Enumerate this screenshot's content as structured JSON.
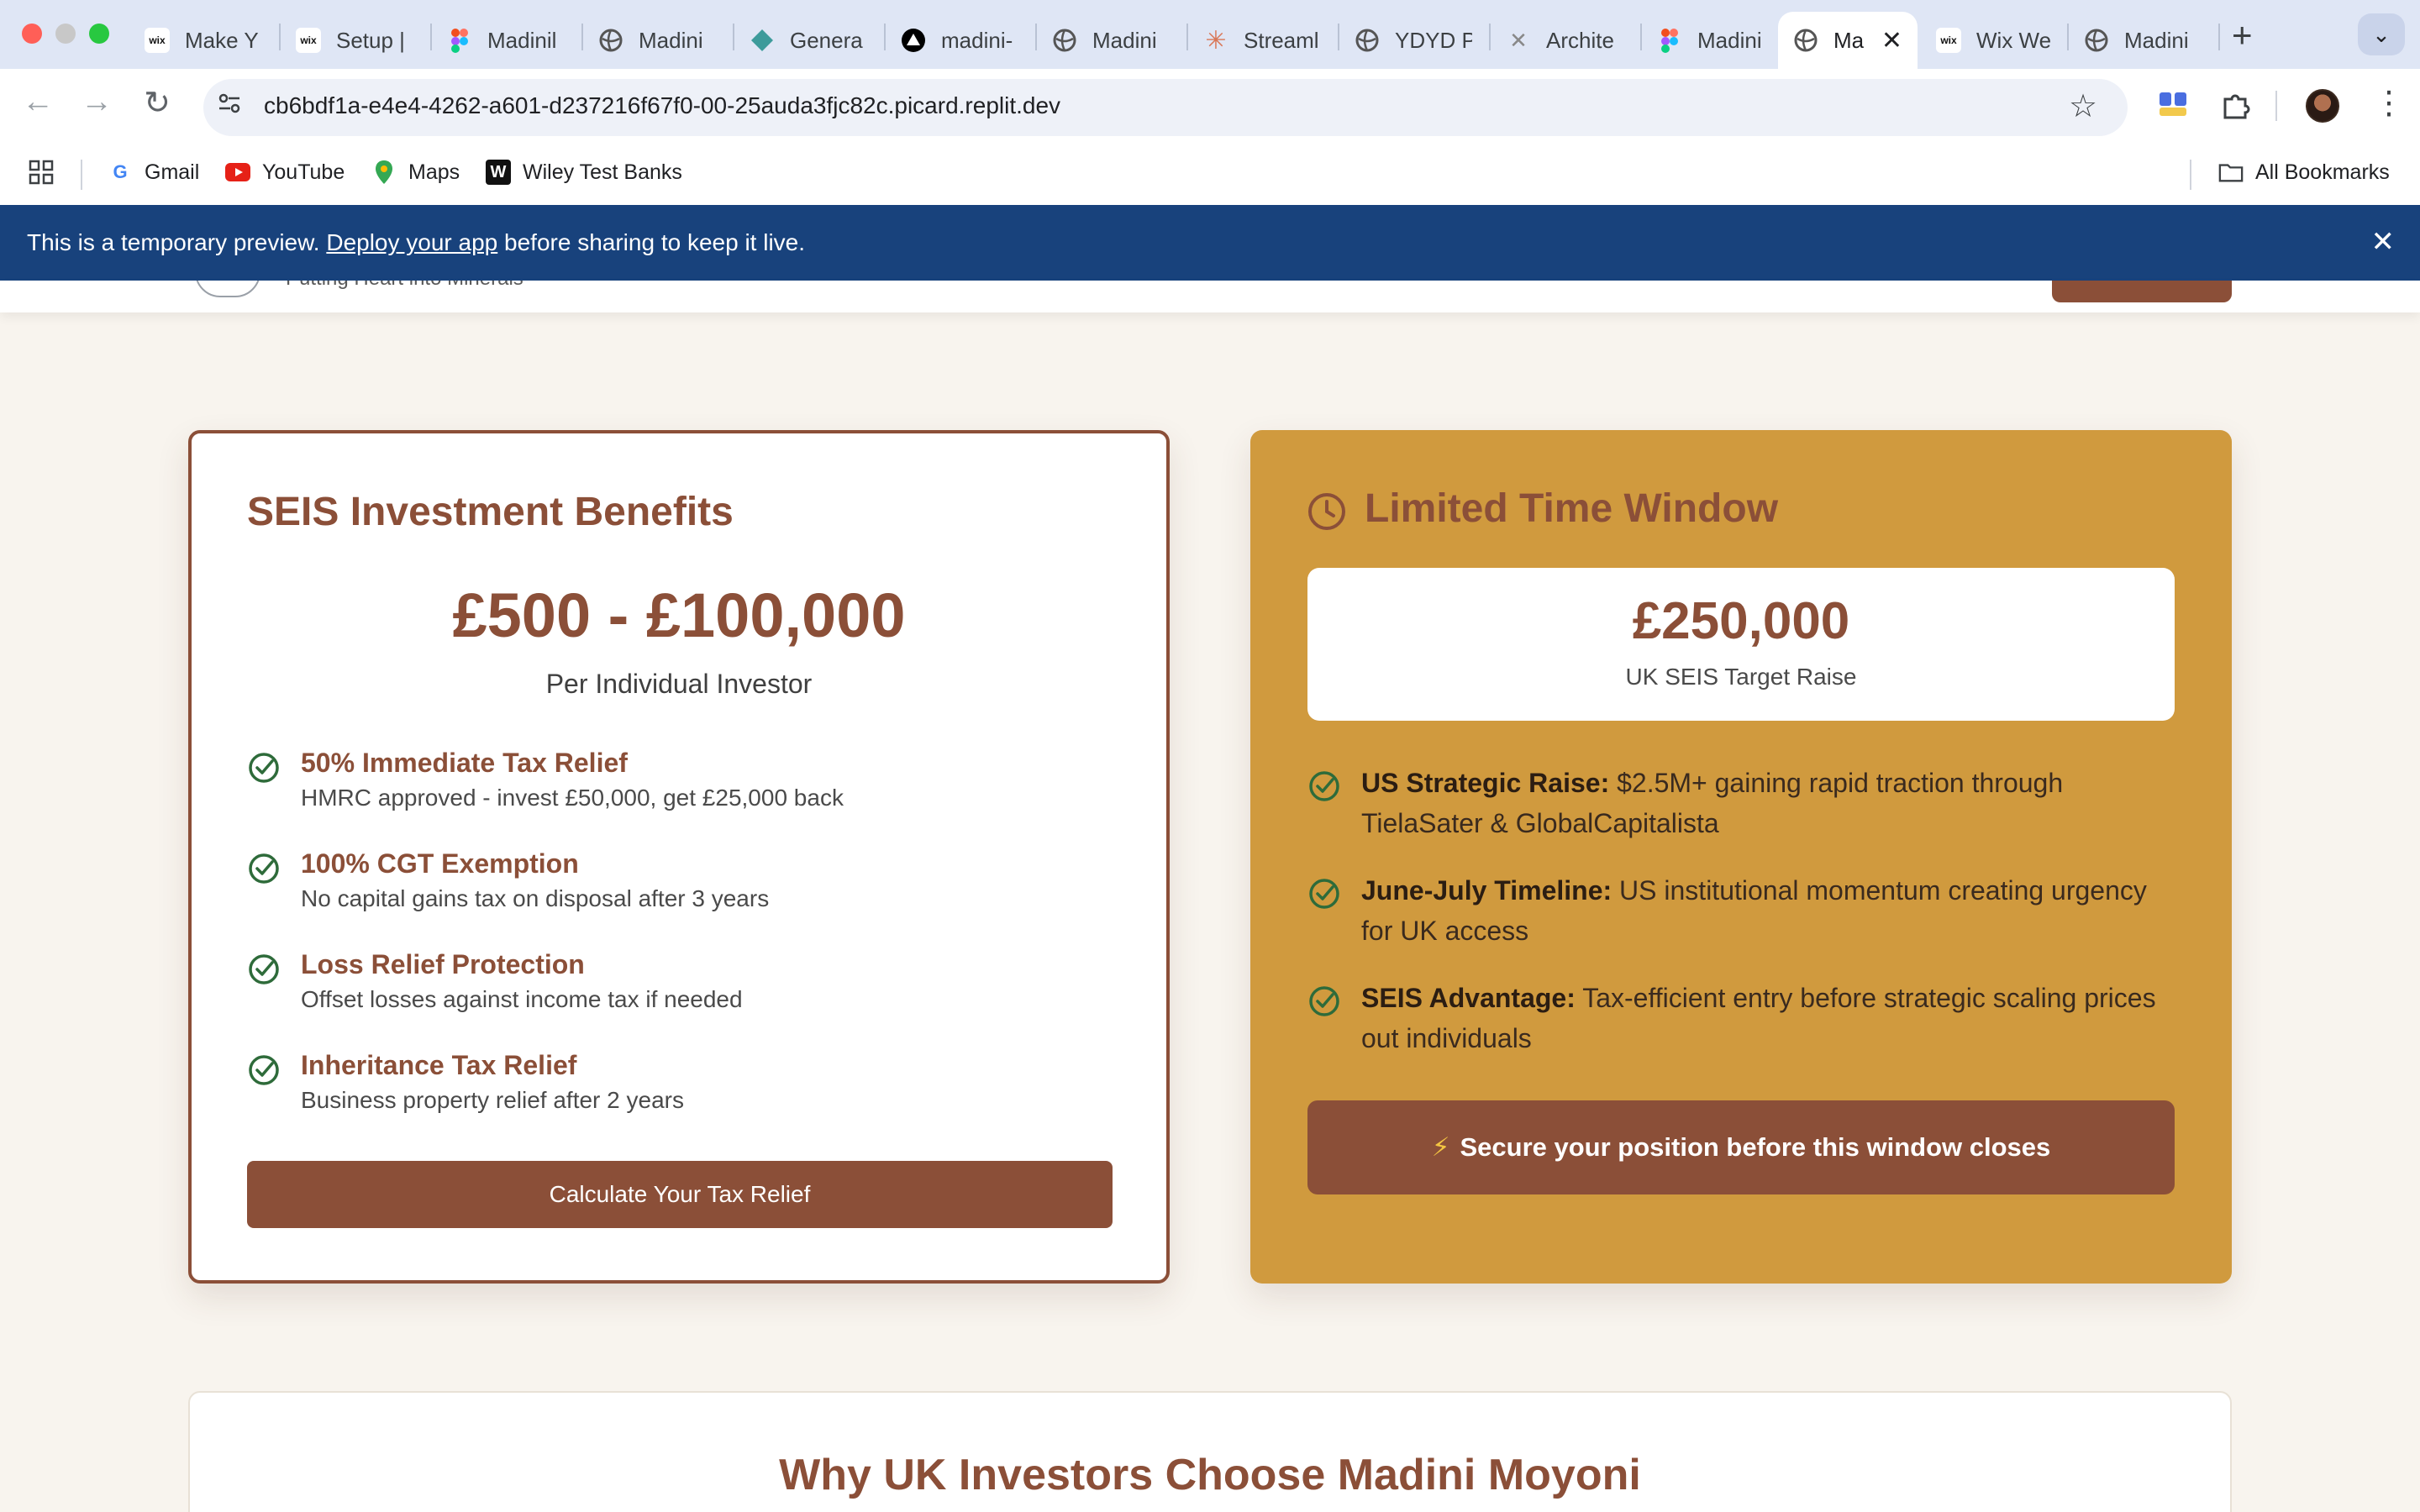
{
  "browser": {
    "tabs": [
      {
        "title": "Make Y",
        "icon": "wix-icon"
      },
      {
        "title": "Setup |",
        "icon": "wix-icon"
      },
      {
        "title": "Madinil",
        "icon": "figma-icon"
      },
      {
        "title": "Madini",
        "icon": "globe-icon"
      },
      {
        "title": "Genera",
        "icon": "diamond-icon"
      },
      {
        "title": "madini-",
        "icon": "vercel-icon"
      },
      {
        "title": "Madini",
        "icon": "globe-icon"
      },
      {
        "title": "Streaml",
        "icon": "sparkle-icon"
      },
      {
        "title": "YDYD P",
        "icon": "globe-icon"
      },
      {
        "title": "Archite",
        "icon": "arch-icon"
      },
      {
        "title": "Madinil",
        "icon": "figma-icon"
      },
      {
        "title": "Ma",
        "icon": "globe-icon",
        "active": true
      },
      {
        "title": "Wix We",
        "icon": "wix-icon"
      },
      {
        "title": "Madini",
        "icon": "globe-icon"
      }
    ],
    "url": "cb6bdf1a-e4e4-4262-a601-d237216f67f0-00-25auda3fjc82c.picard.replit.dev",
    "bookmarks": [
      {
        "label": "Gmail",
        "icon": "google-icon"
      },
      {
        "label": "YouTube",
        "icon": "youtube-icon"
      },
      {
        "label": "Maps",
        "icon": "maps-icon"
      },
      {
        "label": "Wiley Test Banks",
        "icon": "wiley-icon"
      }
    ],
    "all_bookmarks": "All Bookmarks"
  },
  "banner": {
    "prefix": "This is a temporary preview. ",
    "link": "Deploy your app",
    "suffix": " before sharing to keep it live."
  },
  "header": {
    "tagline": "Putting Heart into Minerals"
  },
  "benefits_card": {
    "title": "SEIS Investment Benefits",
    "range": "£500 - £100,000",
    "range_sub": "Per Individual Investor",
    "items": [
      {
        "title": "50% Immediate Tax Relief",
        "desc": "HMRC approved - invest £50,000, get £25,000 back"
      },
      {
        "title": "100% CGT Exemption",
        "desc": "No capital gains tax on disposal after 3 years"
      },
      {
        "title": "Loss Relief Protection",
        "desc": "Offset losses against income tax if needed"
      },
      {
        "title": "Inheritance Tax Relief",
        "desc": "Business property relief after 2 years"
      }
    ],
    "button": "Calculate Your Tax Relief"
  },
  "window_card": {
    "title": "Limited Time Window",
    "target_amount": "£250,000",
    "target_label": "UK SEIS Target Raise",
    "points": [
      {
        "bold": "US Strategic Raise:",
        "text": " $2.5M+ gaining rapid traction through TielaSater & GlobalCapitalista"
      },
      {
        "bold": "June-July Timeline:",
        "text": " US institutional momentum creating urgency for UK access"
      },
      {
        "bold": "SEIS Advantage:",
        "text": " Tax-efficient entry before strategic scaling prices out individuals"
      }
    ],
    "button": "Secure your position before this window closes"
  },
  "why_section": {
    "title": "Why UK Investors Choose Madini Moyoni"
  },
  "colors": {
    "brand_brown": "#8b4f38",
    "gold": "#d09a3e",
    "page_bg": "#f8f4ee",
    "banner_blue": "#18427c",
    "check_green": "#2e6b3a"
  }
}
